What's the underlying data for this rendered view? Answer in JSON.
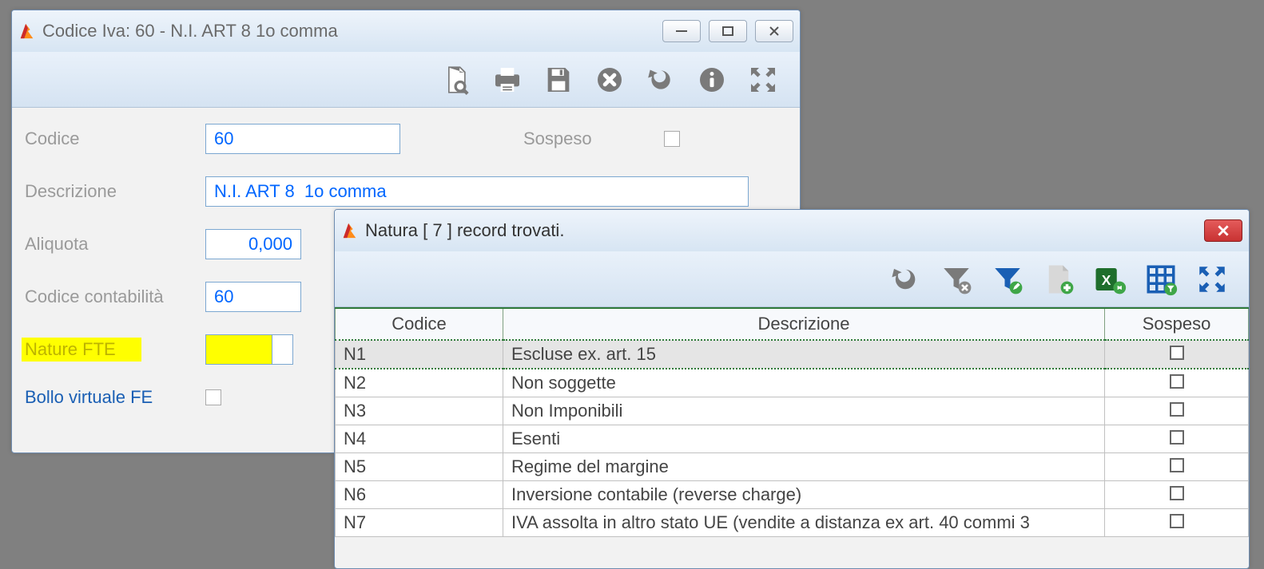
{
  "window1": {
    "title": "Codice Iva: 60 - N.I. ART 8  1o comma",
    "fields": {
      "codice_label": "Codice",
      "codice_value": "60",
      "sospeso_label": "Sospeso",
      "descrizione_label": "Descrizione",
      "descrizione_value": "N.I. ART 8  1o comma",
      "aliquota_label": "Aliquota",
      "aliquota_value": "0,000",
      "codice_cont_label": "Codice contabilità",
      "codice_cont_value": "60",
      "nature_fte_label": "Nature FTE",
      "nature_fte_value": "",
      "bollo_label": "Bollo virtuale FE"
    }
  },
  "window2": {
    "title": "Natura   [ 7 ] record trovati.",
    "columns": {
      "codice": "Codice",
      "descrizione": "Descrizione",
      "sospeso": "Sospeso"
    },
    "rows": [
      {
        "codice": "N1",
        "descrizione": "Escluse ex. art. 15",
        "selected": true
      },
      {
        "codice": "N2",
        "descrizione": "Non soggette"
      },
      {
        "codice": "N3",
        "descrizione": "Non Imponibili"
      },
      {
        "codice": "N4",
        "descrizione": "Esenti"
      },
      {
        "codice": "N5",
        "descrizione": "Regime del margine"
      },
      {
        "codice": "N6",
        "descrizione": "Inversione contabile (reverse charge)"
      },
      {
        "codice": "N7",
        "descrizione": "IVA assolta in altro stato UE (vendite a distanza ex art. 40 commi 3"
      }
    ]
  }
}
